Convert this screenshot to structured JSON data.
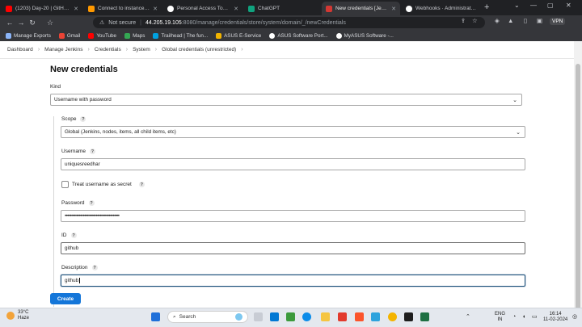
{
  "browser": {
    "tabs": [
      {
        "title": "(1203) Day-20 | GitHub Actions",
        "color": "#ff0000"
      },
      {
        "title": "Connect to instance | EC2 | us-",
        "color": "#ff9900"
      },
      {
        "title": "Personal Access Tokens (Classic",
        "color": "#ffffff"
      },
      {
        "title": "ChatGPT",
        "color": "#10a37f"
      },
      {
        "title": "New credentials [Jenkins]",
        "color": "#d33833"
      },
      {
        "title": "Webhooks · Administration",
        "color": "#ffffff"
      }
    ],
    "security_label": "Not secure",
    "url_host": "44.205.19.105",
    "url_path": ":8080/manage/credentials/store/system/domain/_/newCredentials",
    "vpn_label": "VPN",
    "bookmarks": [
      {
        "label": "Manage Exports",
        "color": "#8ab4f8"
      },
      {
        "label": "Gmail",
        "color": "#ea4335"
      },
      {
        "label": "YouTube",
        "color": "#ff0000"
      },
      {
        "label": "Maps",
        "color": "#34a853"
      },
      {
        "label": "Trailhead | The fun...",
        "color": "#00a1e0"
      },
      {
        "label": "ASUS E-Service",
        "color": "#f2b400"
      },
      {
        "label": "ASUS Software Port...",
        "color": "#ffffff"
      },
      {
        "label": "MyASUS Software -...",
        "color": "#ffffff"
      }
    ]
  },
  "breadcrumb": [
    "Dashboard",
    "Manage Jenkins",
    "Credentials",
    "System",
    "Global credentials (unrestricted)"
  ],
  "page": {
    "title": "New credentials",
    "kind_label": "Kind",
    "kind_value": "Username with password",
    "scope_label": "Scope",
    "scope_value": "Global (Jenkins, nodes, items, all child items, etc)",
    "username_label": "Username",
    "username_value": "uniquesreedhar",
    "treat_secret_label": "Treat username as secret",
    "password_label": "Password",
    "password_value": "••••••••••••••••••••••••••••••••••••••••••",
    "id_label": "ID",
    "id_value": "github",
    "description_label": "Description",
    "description_value": "github",
    "create_label": "Create",
    "help_glyph": "?"
  },
  "taskbar": {
    "temperature": "33°C",
    "condition": "Haze",
    "search_placeholder": "Search",
    "lang_top": "ENG",
    "lang_bottom": "IN",
    "time": "16:14",
    "date": "11-02-2024"
  },
  "colors": {
    "accent": "#1476d9",
    "focus_border": "#1a4f7a"
  }
}
